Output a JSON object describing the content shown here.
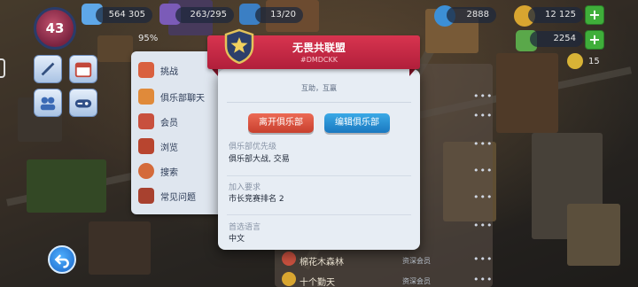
{
  "hud": {
    "level": "43",
    "population": "564 305",
    "storage": "263/295",
    "builders": "13/20",
    "gems": "2888",
    "coins": "12 125",
    "percent": "95%",
    "second_currency": "2254",
    "keys": "15"
  },
  "club_menu": {
    "items": [
      {
        "label": "挑战",
        "icon": "challenge-icon"
      },
      {
        "label": "俱乐部聊天",
        "icon": "chat-icon"
      },
      {
        "label": "会员",
        "icon": "members-icon"
      },
      {
        "label": "浏览",
        "icon": "browse-icon"
      },
      {
        "label": "搜索",
        "icon": "search-icon"
      },
      {
        "label": "常见问题",
        "icon": "faq-icon"
      }
    ]
  },
  "background_list": {
    "rows": [
      {
        "name": "棉花木森林",
        "role": "资深会员"
      },
      {
        "name": "十个勤天",
        "role": "资深会员"
      }
    ]
  },
  "modal": {
    "title": "无畏共联盟",
    "tag": "#DMDCKK",
    "description": "互助，互赢",
    "leave_button": "离开俱乐部",
    "edit_button": "编辑俱乐部",
    "priority_label": "俱乐部优先级",
    "priority_value": "俱乐部大战, 交易",
    "join_label": "加入要求",
    "join_value": "市长竞赛排名 2",
    "language_label": "首选语言",
    "language_value": "中文"
  },
  "colors": {
    "ribbon": "#c8283f",
    "leave": "#d9533f",
    "edit": "#2a91d6",
    "panel": "#e7edf4"
  }
}
